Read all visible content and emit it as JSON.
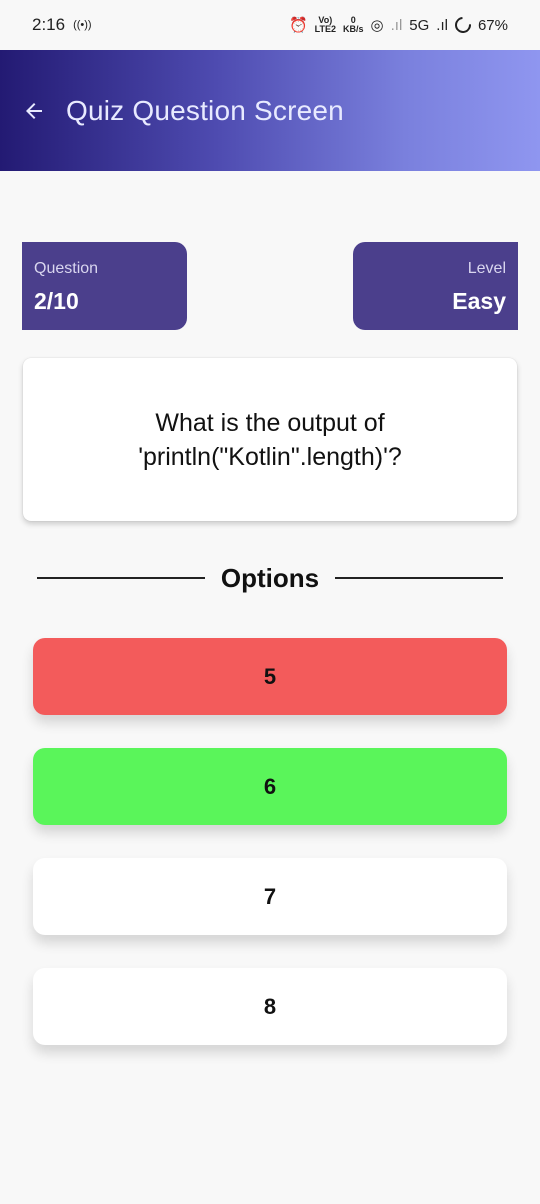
{
  "status_bar": {
    "time": "2:16",
    "volte": "Vo)",
    "lte": "LTE2",
    "speed_value": "0",
    "speed_unit": "KB/s",
    "network": "5G",
    "battery": "67%"
  },
  "app_bar": {
    "title": "Quiz Question Screen"
  },
  "question_info": {
    "label": "Question",
    "value": "2/10"
  },
  "level_info": {
    "label": "Level",
    "value": "Easy"
  },
  "question": {
    "text": "What is the output of 'println(\"Kotlin\".length)'?"
  },
  "options_title": "Options",
  "options": [
    {
      "label": "5",
      "state": "incorrect",
      "color": "#f35b5b"
    },
    {
      "label": "6",
      "state": "correct",
      "color": "#5af55a"
    },
    {
      "label": "7",
      "state": "default",
      "color": "#ffffff"
    },
    {
      "label": "8",
      "state": "default",
      "color": "#ffffff"
    }
  ],
  "colors": {
    "app_bar_start": "#231a73",
    "app_bar_end": "#8f96f0",
    "info_card": "#4b3f8c"
  }
}
